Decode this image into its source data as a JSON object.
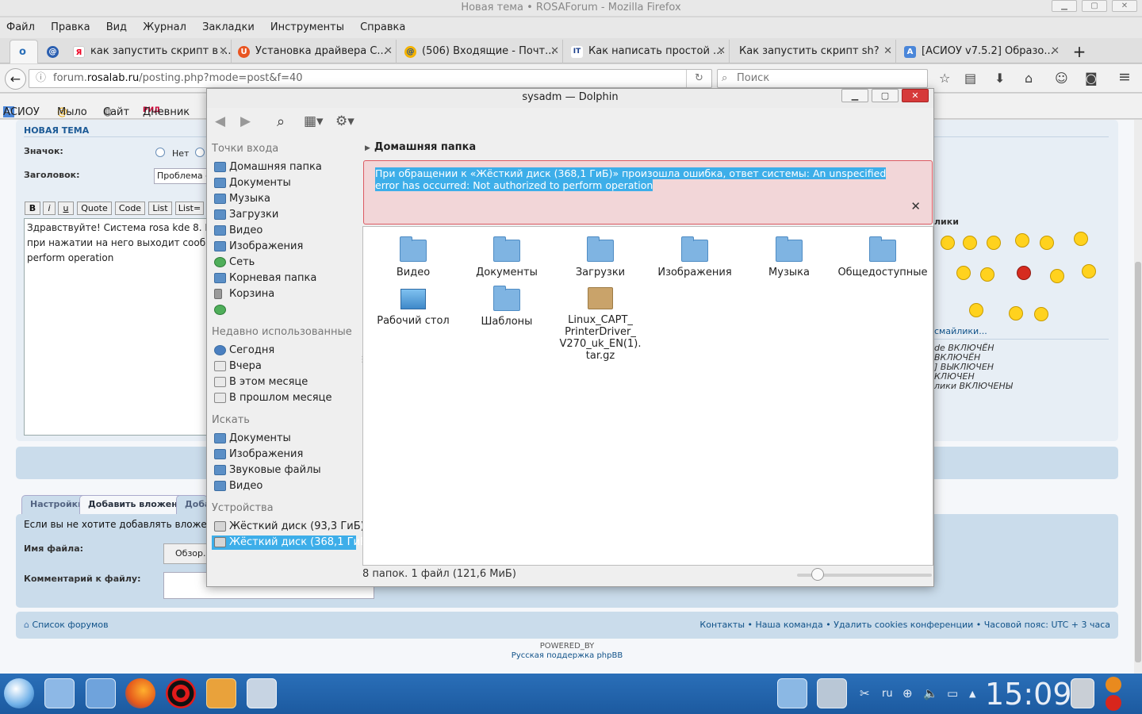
{
  "browser": {
    "title": "Новая тема • ROSAForum - Mozilla Firefox",
    "menu": [
      "Файл",
      "Правка",
      "Вид",
      "Журнал",
      "Закладки",
      "Инструменты",
      "Справка"
    ],
    "tabs": [
      {
        "label": "как запустить скрипт в ...",
        "icon": "Я"
      },
      {
        "label": "Установка драйвера С...",
        "icon": "U"
      },
      {
        "label": "(506) Входящие - Почт...",
        "icon": "@"
      },
      {
        "label": "Как написать простой ...",
        "icon": "IT"
      },
      {
        "label": "Как запустить скрипт sh?",
        "icon": ""
      },
      {
        "label": "[АСИОУ v7.5.2] Образо...",
        "icon": "A"
      }
    ],
    "url_prefix": "forum.",
    "url_domain": "rosalab.ru",
    "url_path": "/posting.php?mode=post&f=40",
    "search_placeholder": "Поиск",
    "bookmarks": [
      "АСИОУ",
      "Мыло",
      "Сайт",
      "Дневник"
    ]
  },
  "forum": {
    "heading": "НОВАЯ ТЕМА",
    "icon_label": "Значок:",
    "icon_none": "Нет",
    "subject_label": "Заголовок:",
    "subject_value": "Проблема с",
    "format_buttons": [
      "B",
      "i",
      "u",
      "Quote",
      "Code",
      "List",
      "List="
    ],
    "body_text": "Здравствуйте! Система rosa kde 8. В\nпри нажатии на него выходит сообще\nperform operation",
    "smilies_header": "лики",
    "more_smilies": "смайлики...",
    "options": [
      "de ВКЛЮЧЁН",
      "ВКЛЮЧЁН",
      "] ВЫКЛЮЧЕН",
      "КЛЮЧЕН",
      "лики ВКЛЮЧЕНЫ"
    ],
    "tabs": [
      "Настройки",
      "Добавить вложения",
      "Доба"
    ],
    "attach_text": "Если вы не хотите добавлять вложения,",
    "filename_label": "Имя файла:",
    "browse_button": "Обзор...",
    "comment_label": "Комментарий к файлу:",
    "footer_left": "Список форумов",
    "footer_right": "Контакты • Наша команда • Удалить cookies конференции • Часовой пояс: UTC + 3 часа",
    "powered_by": "POWERED_BY",
    "support_link": "Русская поддержка phpBB"
  },
  "dolphin": {
    "title": "sysadm — Dolphin",
    "places_header": "Точки входа",
    "places": [
      "Домашняя папка",
      "Документы",
      "Музыка",
      "Загрузки",
      "Видео",
      "Изображения",
      "Сеть",
      "Корневая папка",
      "Корзина",
      ""
    ],
    "recent_header": "Недавно использованные",
    "recent": [
      "Сегодня",
      "Вчера",
      "В этом месяце",
      "В прошлом месяце"
    ],
    "search_header": "Искать",
    "search": [
      "Документы",
      "Изображения",
      "Звуковые файлы",
      "Видео"
    ],
    "devices_header": "Устройства",
    "devices": [
      "Жёсткий диск (93,3 ГиБ)",
      "Жёсткий диск (368,1 ГиБ)"
    ],
    "breadcrumb": "Домашняя папка",
    "error_message": "При обращении к «Жёсткий диск (368,1 ГиБ)» произошла ошибка, ответ системы: An unspecified error has occurred: Not authorized to perform operation",
    "files": [
      "Видео",
      "Документы",
      "Загрузки",
      "Изображения",
      "Музыка",
      "Общедоступные",
      "Рабочий стол",
      "Шаблоны",
      "Linux_CAPT_\nPrinterDriver_\nV270_uk_EN(1).\ntar.gz"
    ],
    "status": "8 папок. 1 файл (121,6 МиБ)",
    "zoom_level": 0.15
  },
  "taskbar": {
    "clock": "15:09",
    "keyboard_layout": "ru"
  }
}
